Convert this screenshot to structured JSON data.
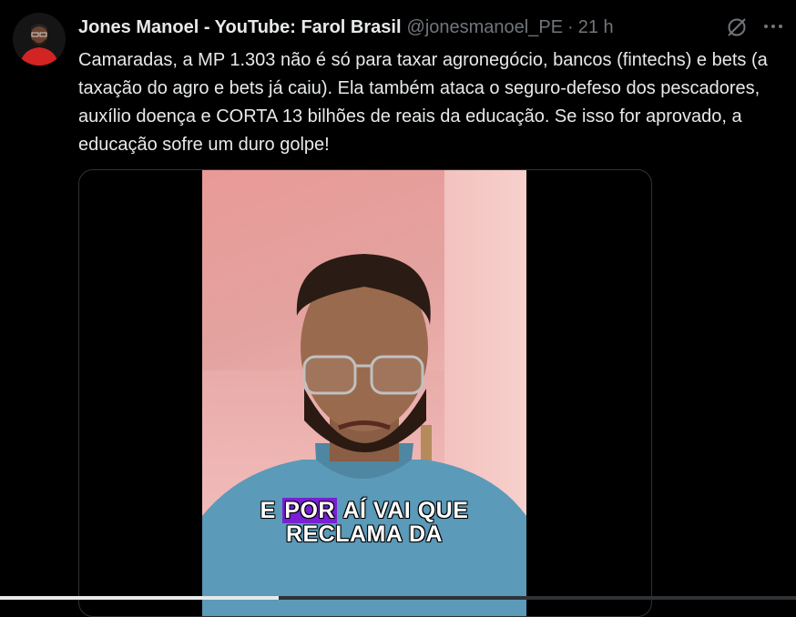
{
  "tweet": {
    "author_name": "Jones Manoel - YouTube: Farol Brasil",
    "handle": "@jonesmanoel_PE",
    "separator": "·",
    "time": "21 h",
    "text": "Camaradas, a MP 1.303 não é só para taxar agronegócio, bancos (fintechs) e bets (a taxação do agro e bets já caiu). Ela também ataca o seguro-defeso dos pescadores, auxílio doença e CORTA 13 bilhões de reais da educação. Se isso for aprovado, a educação sofre um duro golpe!",
    "more_icon": "more-horizontal-icon",
    "grok_icon": "grok-icon"
  },
  "video": {
    "caption_line1_start": "E",
    "caption_highlight": "POR",
    "caption_line1_end": "AÍ VAI QUE",
    "caption_line2": "RECLAMA DA",
    "highlight_color": "#7b1fd6"
  },
  "progress": {
    "fraction": 0.35
  },
  "colors": {
    "background": "#000000",
    "text": "#e7e9ea",
    "secondary": "#71767b",
    "border": "#2f3336"
  }
}
